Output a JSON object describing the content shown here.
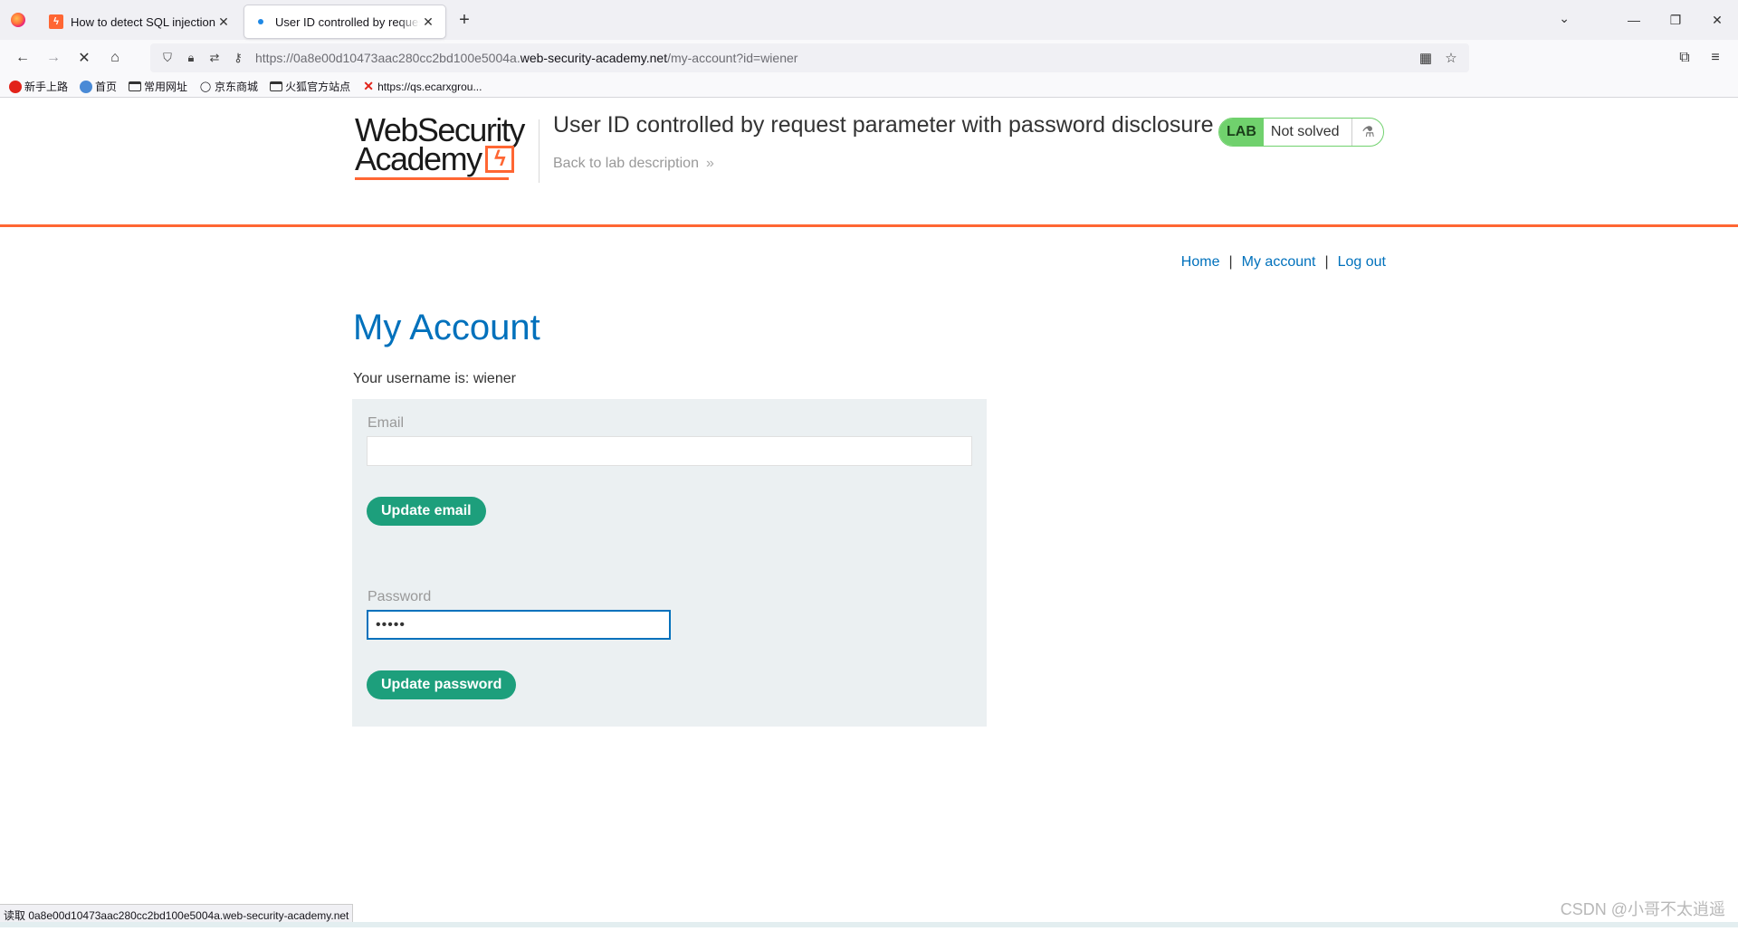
{
  "browser": {
    "tabs": [
      {
        "title": "How to detect SQL injection",
        "active": false
      },
      {
        "title": "User ID controlled by request parameter",
        "active": true
      }
    ],
    "new_tab": "+",
    "url_prefix": "https://0a8e00d10473aac280cc2bd100e5004a.",
    "url_domain": "web-security-academy.net",
    "url_path": "/my-account?id=wiener",
    "bookmarks": [
      "新手上路",
      "首页",
      "常用网址",
      "京东商城",
      "火狐官方站点",
      "https://qs.ecarxgrou..."
    ],
    "status_text": "读取 0a8e00d10473aac280cc2bd100e5004a.web-security-academy.net"
  },
  "lab": {
    "logo_line1": "WebSecurity",
    "logo_line2": "Academy",
    "title": "User ID controlled by request parameter with password disclosure",
    "back_link": "Back to lab description",
    "badge": "LAB",
    "status": "Not solved"
  },
  "nav": {
    "home": "Home",
    "separator": "|",
    "account": "My account",
    "logout": "Log out"
  },
  "account": {
    "heading": "My Account",
    "username_text": "Your username is: wiener",
    "email_label": "Email",
    "email_value": "",
    "update_email": "Update email",
    "password_label": "Password",
    "password_value": "•••••",
    "update_password": "Update password"
  },
  "watermark": "CSDN @小哥不太逍遥",
  "colors": {
    "accent_orange": "#ff6633",
    "link_blue": "#0071bc",
    "button_green": "#1d9f7c",
    "lab_green": "#70d16d"
  }
}
